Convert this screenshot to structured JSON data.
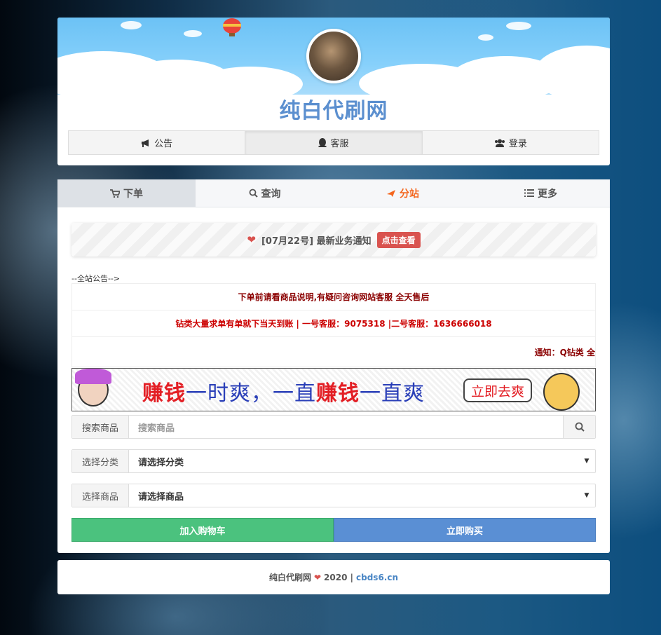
{
  "site": {
    "title": "纯白代刷网"
  },
  "top_nav": [
    {
      "label": "公告",
      "icon": "bullhorn-icon"
    },
    {
      "label": "客服",
      "icon": "qq-icon"
    },
    {
      "label": "登录",
      "icon": "users-icon"
    }
  ],
  "tabs": [
    {
      "label": "下单",
      "icon": "cart-icon"
    },
    {
      "label": "查询",
      "icon": "search-icon"
    },
    {
      "label": "分站",
      "icon": "plane-icon"
    },
    {
      "label": "更多",
      "icon": "list-icon"
    }
  ],
  "notice": {
    "text": "[07月22号] 最新业务通知",
    "button": "点击查看"
  },
  "announcements": {
    "label": "--全站公告-->",
    "lines": [
      "下单前请看商品说明,有疑问咨询网站客服 全天售后",
      "钻类大量求单有单就下当天到账 | 一号客服：9075318 |二号客服：1636666018",
      "通知：Q钻类 全"
    ]
  },
  "banner": {
    "part1": "赚钱",
    "part2": "一时爽，一直",
    "part3": "赚钱",
    "part4": "一直爽",
    "button": "立即去爽"
  },
  "form": {
    "search_label": "搜索商品",
    "search_placeholder": "搜索商品",
    "category_label": "选择分类",
    "category_value": "请选择分类",
    "product_label": "选择商品",
    "product_value": "请选择商品",
    "caret": "▼"
  },
  "buttons": {
    "cart": "加入购物车",
    "buy": "立即购买"
  },
  "footer": {
    "name": "纯白代刷网",
    "year": "2020 |",
    "domain": "cbds6.cn"
  },
  "colors": {
    "accent": "#5b8fcf",
    "green": "#4bc27e",
    "blue": "#5a8fd4",
    "orange": "#f4661e",
    "red": "#d9534f"
  }
}
